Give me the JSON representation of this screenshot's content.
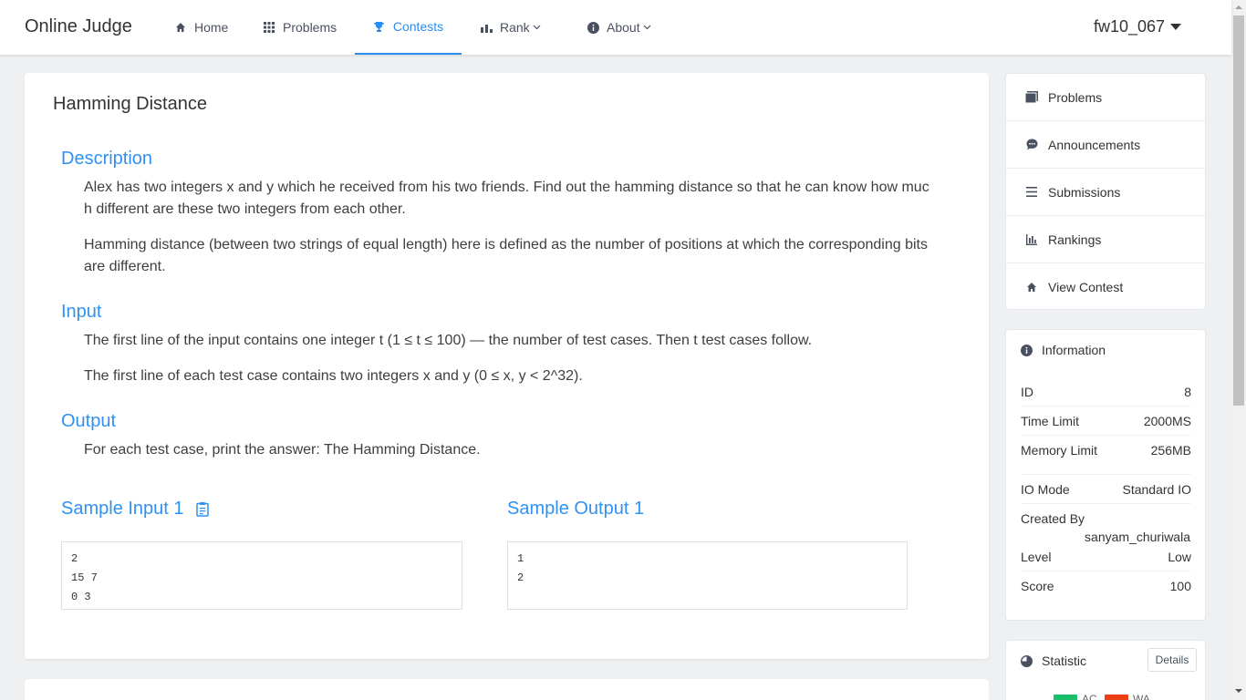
{
  "header": {
    "logo": "Online Judge",
    "nav": [
      {
        "label": "Home",
        "icon": "home-icon"
      },
      {
        "label": "Problems",
        "icon": "grid-icon"
      },
      {
        "label": "Contests",
        "icon": "trophy-icon",
        "active": true
      },
      {
        "label": "Rank",
        "icon": "bar-chart-icon",
        "dropdown": true
      },
      {
        "label": "About",
        "icon": "info-icon",
        "dropdown": true
      }
    ],
    "user": "fw10_067"
  },
  "problem": {
    "title": "Hamming Distance",
    "description_title": "Description",
    "description": [
      "Alex has two integers x and y which he received from his two friends. Find out the hamming distance so that he can know how much different are these two integers from each other.",
      "Hamming distance (between two strings of equal length) here is defined as the number of positions at which the corresponding bits are different."
    ],
    "input_title": "Input",
    "input": [
      "The first line of the input contains one integer t (1 ≤ t ≤ 100) — the number of test cases. Then t test cases follow.",
      "The first line of each test case contains two integers x and y (0 ≤ x, y < 2^32)."
    ],
    "output_title": "Output",
    "output": [
      "For each test case, print the answer: The Hamming Distance."
    ],
    "sample_input_title": "Sample Input 1",
    "sample_output_title": "Sample Output 1",
    "sample_input": [
      "2",
      "15 7",
      "0 3"
    ],
    "sample_output": [
      "1",
      "2"
    ]
  },
  "sidebar": {
    "menu": [
      {
        "label": "Problems",
        "icon": "problems-icon"
      },
      {
        "label": "Announcements",
        "icon": "chat-icon"
      },
      {
        "label": "Submissions",
        "icon": "list-icon"
      },
      {
        "label": "Rankings",
        "icon": "bar-chart-icon"
      },
      {
        "label": "View Contest",
        "icon": "home-icon"
      }
    ],
    "info": {
      "title": "Information",
      "rows": [
        {
          "label": "ID",
          "value": "8"
        },
        {
          "label": "Time Limit",
          "value": "2000MS"
        },
        {
          "label": "Memory Limit",
          "value": "256MB"
        },
        {
          "label": "IO Mode",
          "value": "Standard IO"
        },
        {
          "label": "Created By",
          "value": "sanyam_churiwala"
        },
        {
          "label": "Level",
          "value": "Low"
        },
        {
          "label": "Score",
          "value": "100"
        }
      ]
    },
    "statistic": {
      "title": "Statistic",
      "details_label": "Details",
      "legend": [
        {
          "label": "AC",
          "color": "#19be6b"
        },
        {
          "label": "WA",
          "color": "#ed3f14"
        }
      ]
    }
  },
  "colors": {
    "accent": "#2d8cf0",
    "section_title": "#3091f2"
  }
}
